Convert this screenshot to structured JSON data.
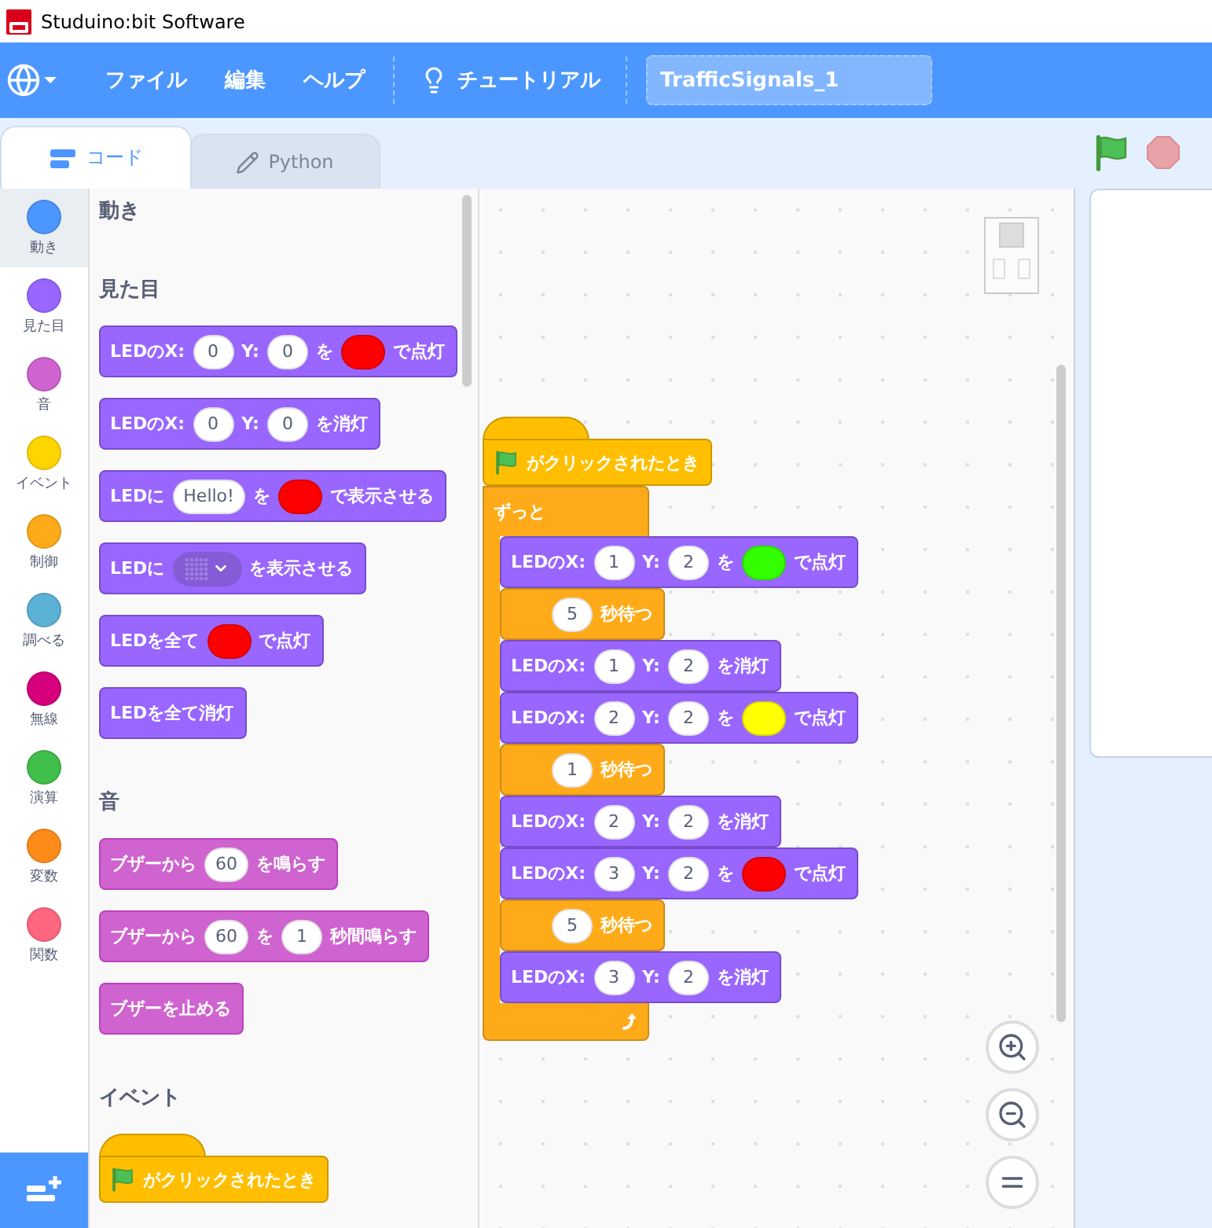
{
  "window": {
    "title": "Studuino:bit Software"
  },
  "menu_bar": {
    "items": [
      {
        "label": "ファイル"
      },
      {
        "label": "編集"
      },
      {
        "label": "ヘルプ"
      }
    ],
    "tutorial": "チュートリアル",
    "project_name": "TrafficSignals_1"
  },
  "tabs": [
    {
      "label": "コード",
      "kind": "code",
      "selected": true
    },
    {
      "label": "Python",
      "kind": "python",
      "selected": false
    }
  ],
  "categories": [
    {
      "label": "動き",
      "color": "#4c97ff",
      "selected": true
    },
    {
      "label": "見た目",
      "color": "#9966ff",
      "selected": false
    },
    {
      "label": "音",
      "color": "#cf63cf",
      "selected": false
    },
    {
      "label": "イベント",
      "color": "#ffd500",
      "selected": false
    },
    {
      "label": "制御",
      "color": "#ffab19",
      "selected": false
    },
    {
      "label": "調べる",
      "color": "#5cb1d6",
      "selected": false
    },
    {
      "label": "無線",
      "color": "#d6007d",
      "selected": false
    },
    {
      "label": "演算",
      "color": "#40bf4a",
      "selected": false
    },
    {
      "label": "変数",
      "color": "#ff8c1a",
      "selected": false
    },
    {
      "label": "関数",
      "color": "#ff6680",
      "selected": false
    }
  ],
  "palette": [
    {
      "title": "動き"
    },
    {
      "title": "見た目",
      "blocks": [
        {
          "kind": "looks",
          "parts": [
            {
              "kind": "text",
              "text": "LEDのX:"
            },
            {
              "kind": "number",
              "text": "0"
            },
            {
              "kind": "text",
              "text": "Y:"
            },
            {
              "kind": "number",
              "text": "0"
            },
            {
              "kind": "text",
              "text": "を"
            },
            {
              "kind": "color",
              "color": "#ff0000"
            },
            {
              "kind": "text",
              "text": "で点灯"
            }
          ]
        },
        {
          "kind": "looks",
          "parts": [
            {
              "kind": "text",
              "text": "LEDのX:"
            },
            {
              "kind": "number",
              "text": "0"
            },
            {
              "kind": "text",
              "text": "Y:"
            },
            {
              "kind": "number",
              "text": "0"
            },
            {
              "kind": "text",
              "text": "を消灯"
            }
          ]
        },
        {
          "kind": "looks",
          "parts": [
            {
              "kind": "text",
              "text": "LEDに"
            },
            {
              "kind": "string",
              "text": "Hello!"
            },
            {
              "kind": "text",
              "text": "を"
            },
            {
              "kind": "color",
              "color": "#ff0000"
            },
            {
              "kind": "text",
              "text": "で表示させる"
            }
          ]
        },
        {
          "kind": "looks",
          "parts": [
            {
              "kind": "text",
              "text": "LEDに"
            },
            {
              "kind": "matrix"
            },
            {
              "kind": "text",
              "text": "を表示させる"
            }
          ]
        },
        {
          "kind": "looks",
          "parts": [
            {
              "kind": "text",
              "text": "LEDを全て"
            },
            {
              "kind": "color",
              "color": "#ff0000"
            },
            {
              "kind": "text",
              "text": "で点灯"
            }
          ]
        },
        {
          "kind": "looks",
          "parts": [
            {
              "kind": "text",
              "text": "LEDを全て消灯"
            }
          ]
        }
      ]
    },
    {
      "title": "音",
      "blocks": [
        {
          "kind": "sound",
          "parts": [
            {
              "kind": "text",
              "text": "ブザーから"
            },
            {
              "kind": "number",
              "text": "60"
            },
            {
              "kind": "text",
              "text": "を鳴らす"
            }
          ]
        },
        {
          "kind": "sound",
          "parts": [
            {
              "kind": "text",
              "text": "ブザーから"
            },
            {
              "kind": "number",
              "text": "60"
            },
            {
              "kind": "text",
              "text": "を"
            },
            {
              "kind": "number",
              "text": "1"
            },
            {
              "kind": "text",
              "text": "秒間鳴らす"
            }
          ]
        },
        {
          "kind": "sound",
          "parts": [
            {
              "kind": "text",
              "text": "ブザーを止める"
            }
          ]
        }
      ]
    },
    {
      "title": "イベント",
      "blocks": [
        {
          "kind": "hat",
          "parts": [
            {
              "kind": "flag"
            },
            {
              "kind": "text",
              "text": "がクリックされたとき"
            }
          ]
        }
      ]
    }
  ],
  "script": {
    "hat": {
      "kind": "hat",
      "parts": [
        {
          "kind": "flag"
        },
        {
          "kind": "text",
          "text": "がクリックされたとき"
        }
      ]
    },
    "loop": {
      "label": "ずっと",
      "body": [
        {
          "kind": "looks",
          "parts": [
            {
              "kind": "text",
              "text": "LEDのX:"
            },
            {
              "kind": "number",
              "text": "1"
            },
            {
              "kind": "text",
              "text": "Y:"
            },
            {
              "kind": "number",
              "text": "2"
            },
            {
              "kind": "text",
              "text": "を"
            },
            {
              "kind": "color",
              "color": "#33ff00"
            },
            {
              "kind": "text",
              "text": "で点灯"
            }
          ]
        },
        {
          "kind": "control",
          "parts": [
            {
              "kind": "number",
              "text": "5"
            },
            {
              "kind": "text",
              "text": "秒待つ"
            }
          ]
        },
        {
          "kind": "looks",
          "parts": [
            {
              "kind": "text",
              "text": "LEDのX:"
            },
            {
              "kind": "number",
              "text": "1"
            },
            {
              "kind": "text",
              "text": "Y:"
            },
            {
              "kind": "number",
              "text": "2"
            },
            {
              "kind": "text",
              "text": "を消灯"
            }
          ]
        },
        {
          "kind": "looks",
          "parts": [
            {
              "kind": "text",
              "text": "LEDのX:"
            },
            {
              "kind": "number",
              "text": "2"
            },
            {
              "kind": "text",
              "text": "Y:"
            },
            {
              "kind": "number",
              "text": "2"
            },
            {
              "kind": "text",
              "text": "を"
            },
            {
              "kind": "color",
              "color": "#ffff00"
            },
            {
              "kind": "text",
              "text": "で点灯"
            }
          ]
        },
        {
          "kind": "control",
          "parts": [
            {
              "kind": "number",
              "text": "1"
            },
            {
              "kind": "text",
              "text": "秒待つ"
            }
          ]
        },
        {
          "kind": "looks",
          "parts": [
            {
              "kind": "text",
              "text": "LEDのX:"
            },
            {
              "kind": "number",
              "text": "2"
            },
            {
              "kind": "text",
              "text": "Y:"
            },
            {
              "kind": "number",
              "text": "2"
            },
            {
              "kind": "text",
              "text": "を消灯"
            }
          ]
        },
        {
          "kind": "looks",
          "parts": [
            {
              "kind": "text",
              "text": "LEDのX:"
            },
            {
              "kind": "number",
              "text": "3"
            },
            {
              "kind": "text",
              "text": "Y:"
            },
            {
              "kind": "number",
              "text": "2"
            },
            {
              "kind": "text",
              "text": "を"
            },
            {
              "kind": "color",
              "color": "#ff0000"
            },
            {
              "kind": "text",
              "text": "で点灯"
            }
          ]
        },
        {
          "kind": "control",
          "parts": [
            {
              "kind": "number",
              "text": "5"
            },
            {
              "kind": "text",
              "text": "秒待つ"
            }
          ]
        },
        {
          "kind": "looks",
          "parts": [
            {
              "kind": "text",
              "text": "LEDのX:"
            },
            {
              "kind": "number",
              "text": "3"
            },
            {
              "kind": "text",
              "text": "Y:"
            },
            {
              "kind": "number",
              "text": "2"
            },
            {
              "kind": "text",
              "text": "を消灯"
            }
          ]
        }
      ]
    }
  }
}
